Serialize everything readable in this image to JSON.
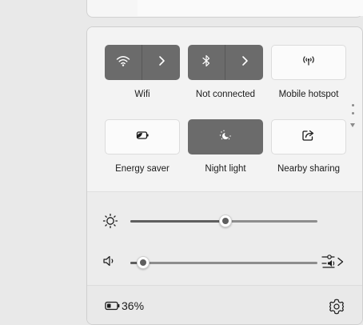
{
  "tiles": [
    {
      "label": "Wifi",
      "icon": "wifi-icon",
      "active": true,
      "has_arrow": true
    },
    {
      "label": "Not connected",
      "icon": "bluetooth-icon",
      "active": true,
      "has_arrow": true
    },
    {
      "label": "Mobile hotspot",
      "icon": "mobile-hotspot-icon",
      "active": false,
      "has_arrow": false
    },
    {
      "label": "Energy saver",
      "icon": "energy-saver-icon",
      "active": false,
      "has_arrow": false
    },
    {
      "label": "Night light",
      "icon": "night-light-icon",
      "active": true,
      "has_arrow": false
    },
    {
      "label": "Nearby sharing",
      "icon": "nearby-sharing-icon",
      "active": false,
      "has_arrow": false
    }
  ],
  "brightness": {
    "icon": "brightness-icon",
    "level": 0.51
  },
  "volume": {
    "icon": "speaker-icon",
    "level": 0.07,
    "output_icon": "audio-output-icon"
  },
  "footer": {
    "battery_icon": "battery-icon",
    "battery_text": "36%",
    "settings_icon": "settings-gear-icon"
  },
  "colors": {
    "tile_active": "#6b6b6b",
    "tile_inactive": "#fbfbfb",
    "slider_fill": "#5e5e5e"
  }
}
